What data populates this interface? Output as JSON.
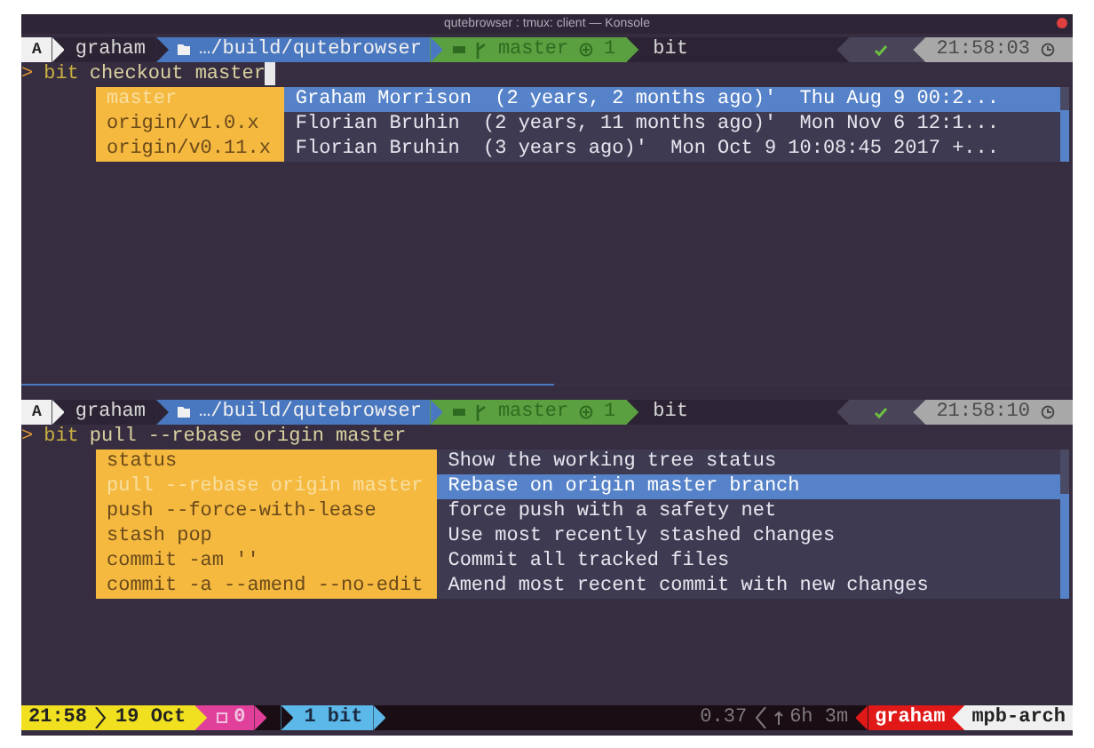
{
  "window": {
    "title": "qutebrowser : tmux: client — Konsole"
  },
  "panes": [
    {
      "active": false,
      "prompt": {
        "badge": "A",
        "user": "graham",
        "path": "…/build/qutebrowser",
        "branch": "master",
        "ahead": "1",
        "program": "bit",
        "time": "21:58:03"
      },
      "command": {
        "marker": ">",
        "program": "bit",
        "args": "checkout master",
        "cursor": true
      },
      "completion": {
        "rows": [
          {
            "name": "master",
            "description": "Graham Morrison  (2 years, 2 months ago)'  Thu Aug 9 00:2...",
            "selected": true
          },
          {
            "name": "origin/v1.0.x",
            "description": "Florian Bruhin  (2 years, 11 months ago)'  Mon Nov 6 12:1...",
            "selected": false
          },
          {
            "name": "origin/v0.11.x",
            "description": "Florian Bruhin  (3 years ago)'  Mon Oct 9 10:08:45 2017 +...",
            "selected": false
          }
        ]
      }
    },
    {
      "active": true,
      "prompt": {
        "badge": "A",
        "user": "graham",
        "path": "…/build/qutebrowser",
        "branch": "master",
        "ahead": "1",
        "program": "bit",
        "time": "21:58:10"
      },
      "command": {
        "marker": ">",
        "program": "bit",
        "args": "pull --rebase origin master",
        "cursor": false
      },
      "completion": {
        "rows": [
          {
            "name": "status",
            "description": "Show the working tree status",
            "selected": false
          },
          {
            "name": "pull --rebase origin master",
            "description": "Rebase on origin master branch",
            "selected": true
          },
          {
            "name": "push --force-with-lease",
            "description": "force push with a safety net",
            "selected": false
          },
          {
            "name": "stash pop",
            "description": "Use most recently stashed changes",
            "selected": false
          },
          {
            "name": "commit -am ''",
            "description": "Commit all tracked files",
            "selected": false
          },
          {
            "name": "commit -a --amend --no-edit",
            "description": "Amend most recent commit with new changes",
            "selected": false
          }
        ]
      }
    }
  ],
  "status_bar": {
    "time": "21:58",
    "date": "19 Oct",
    "window_count": "0",
    "session": "1 bit",
    "load": "0.37",
    "uptime": "6h 3m",
    "user": "graham",
    "host": "mpb-arch"
  }
}
